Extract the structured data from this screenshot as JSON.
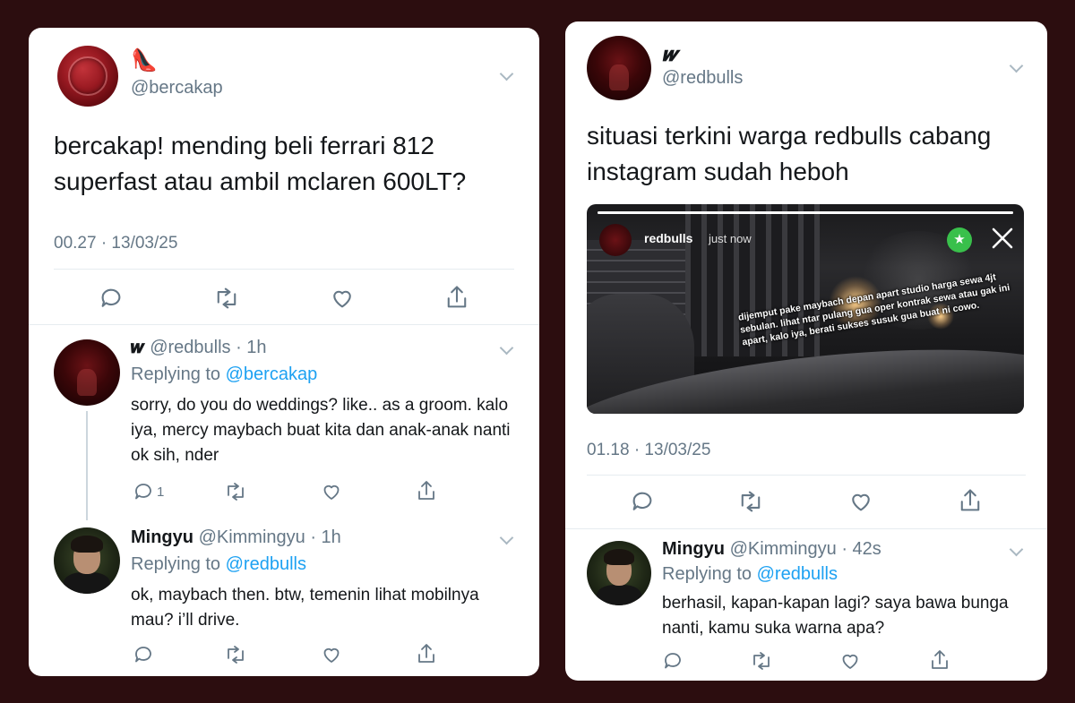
{
  "left_card": {
    "main_tweet": {
      "display_name": "👠",
      "handle": "@bercakap",
      "text": "bercakap! mending beli ferrari 812 superfast atau ambil mclaren 600LT?",
      "timestamp": "00.27 · 13/03/25"
    },
    "replies": [
      {
        "display_name": "𝒘",
        "handle_time": "@redbulls · 1h",
        "replying_label": "Replying to ",
        "replying_to": "@bercakap",
        "text": "sorry, do you do weddings? like.. as a groom. kalo iya, mercy maybach buat kita dan anak-anak nanti ok sih, nder",
        "reply_count": "1"
      },
      {
        "display_name": "Mingyu",
        "handle_time": "@Kimmingyu · 1h",
        "replying_label": "Replying to ",
        "replying_to": "@redbulls",
        "text": "ok, maybach then. btw, temenin lihat mobilnya mau? i’ll drive."
      }
    ]
  },
  "right_card": {
    "main_tweet": {
      "display_name": "𝒘",
      "handle": "@redbulls",
      "text": "situasi terkini warga redbulls cabang instagram sudah heboh",
      "timestamp": "01.18 · 13/03/25"
    },
    "story": {
      "username": "redbulls",
      "time": "just now",
      "caption": "dijemput pake maybach depan apart studio harga sewa 4jt sebulan. lihat ntar pulang gua oper kontrak sewa atau gak ini apart, kalo iya, berati sukses susuk gua buat ni cowo."
    },
    "reply": {
      "display_name": "Mingyu",
      "handle_time": "@Kimmingyu · 42s",
      "replying_label": "Replying to ",
      "replying_to": "@redbulls",
      "text": "berhasil, kapan-kapan lagi? saya bawa bunga nanti, kamu suka warna apa?"
    }
  },
  "colors": {
    "background": "#2c0d0f",
    "card": "#ffffff",
    "text": "#14171a",
    "muted": "#657786",
    "link": "#1da1f2",
    "divider": "#e6ecf0",
    "close_friends_badge": "#39c04b"
  },
  "icons": [
    "chevron-down-icon",
    "reply-icon",
    "retweet-icon",
    "like-icon",
    "share-icon",
    "close-friends-star-icon",
    "close-icon"
  ]
}
